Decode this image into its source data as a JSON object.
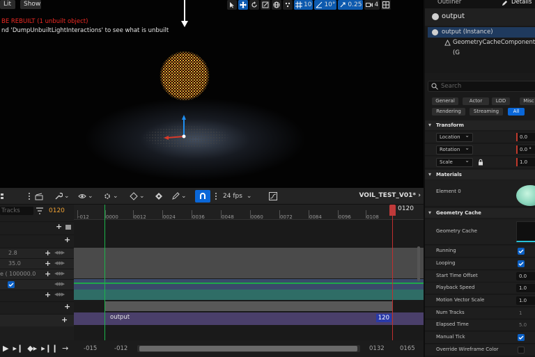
{
  "viewport": {
    "lit_label": "Lit",
    "show_label": "Show",
    "error_text": "BE REBUILT (1 unbuilt object)",
    "message_text": "nd 'DumpUnbuiltLightInteractions' to see what is unbuilt",
    "faint_text": "",
    "toolbar": {
      "grid_value": "10",
      "angle_value": "10°",
      "scale_value": "0.25",
      "camera_value": "4"
    }
  },
  "sequencer": {
    "search_placeholder": "Tracks",
    "current_frame": "0120",
    "fps_label": "24 fps",
    "sequence_name": "VOIL_TEST_V01*",
    "playhead_frame": "0120",
    "ruler_ticks": [
      "-012",
      "0000",
      "0012",
      "0024",
      "0036",
      "0048",
      "0060",
      "0072",
      "0084",
      "0096",
      "0108"
    ],
    "track_values": [
      "2.8",
      "35.0",
      "e ( 100000.0"
    ],
    "section_label": "output",
    "section_end": "120",
    "range_start_outer": "-015",
    "range_start_inner": "-012",
    "range_end_inner": "0132",
    "range_end_outer": "0165"
  },
  "panel": {
    "tabs": {
      "outliner": "Outliner",
      "details": "Details"
    },
    "object_title": "output",
    "tree": {
      "root": "output (Instance)",
      "child": "GeometryCacheComponent (G"
    },
    "search_placeholder": "Search",
    "filters_row1": [
      "General",
      "Actor",
      "LOD",
      "Misc"
    ],
    "filters_row2": [
      "Rendering",
      "Streaming",
      "All"
    ],
    "transform": {
      "category": "Transform",
      "location_label": "Location",
      "location_value": "0.0",
      "rotation_label": "Rotation",
      "rotation_value": "0.0 °",
      "scale_label": "Scale",
      "scale_value": "1.0"
    },
    "materials": {
      "category": "Materials",
      "element_label": "Element 0"
    },
    "geometry_cache": {
      "category": "Geometry Cache",
      "geometry_cache_label": "Geometry Cache",
      "running_label": "Running",
      "looping_label": "Looping",
      "start_time_offset_label": "Start Time Offset",
      "start_time_offset_value": "0.0",
      "playback_speed_label": "Playback Speed",
      "playback_speed_value": "1.0",
      "motion_vector_scale_label": "Motion Vector Scale",
      "motion_vector_scale_value": "1.0",
      "num_tracks_label": "Num Tracks",
      "num_tracks_value": "1",
      "elapsed_time_label": "Elapsed Time",
      "elapsed_time_value": "5.0",
      "manual_tick_label": "Manual Tick",
      "override_wireframe_label": "Override Wireframe Color"
    }
  },
  "colors": {
    "accent": "#0a67d8",
    "error": "#f02a24",
    "current_frame": "#f0a234",
    "section": "#4a3f6a",
    "cache_lane": "#2f6d66"
  }
}
